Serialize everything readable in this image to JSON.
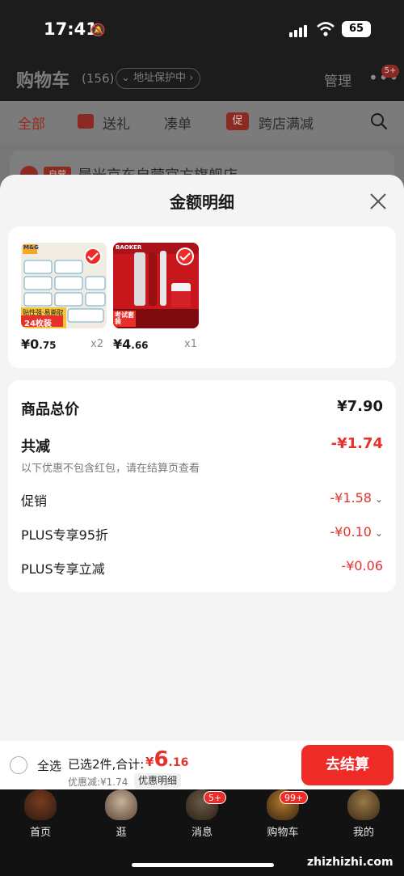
{
  "status_bar": {
    "time": "17:41",
    "battery": "65"
  },
  "header": {
    "title": "购物车",
    "count": "(156)",
    "address_protect": "地址保护中",
    "manage": "管理",
    "more_badge": "5+"
  },
  "filters": [
    {
      "label": "全部"
    },
    {
      "label": "送礼"
    },
    {
      "label": "凑单"
    },
    {
      "label": "跨店满减",
      "tag": "促"
    }
  ],
  "shop": {
    "badge": "自营",
    "name": "晨光京东自营官方旗舰店"
  },
  "sheet": {
    "title": "金额明细",
    "products": [
      {
        "price_int": "¥0",
        "price_dec": ".75",
        "qty": "x2",
        "thumb_tag": "24枚装",
        "thumb_brand": "M&G",
        "thumb_caption": "贴性强·易撕取"
      },
      {
        "price_int": "¥4",
        "price_dec": ".66",
        "qty": "x1",
        "thumb_tag": "考试套装",
        "thumb_brand": "BAOKER"
      }
    ],
    "summary": {
      "goods_total_label": "商品总价",
      "goods_total_value": "¥7.90",
      "total_discount_label": "共减",
      "total_discount_value": "-¥1.74",
      "note": "以下优惠不包含红包，请在结算页查看",
      "rows": [
        {
          "label": "促销",
          "value": "-¥1.58"
        },
        {
          "label": "PLUS专享95折",
          "value": "-¥0.10"
        },
        {
          "label": "PLUS专享立减",
          "value": "-¥0.06"
        }
      ]
    }
  },
  "bottom_bar": {
    "select_all": "全选",
    "selected": "已选2件,合计:",
    "currency": "¥",
    "total_int": "6",
    "total_dec": ".16",
    "discount": "优惠减:¥1.74",
    "detail": "优惠明细",
    "checkout": "去结算"
  },
  "tabbar": [
    {
      "label": "首页"
    },
    {
      "label": "逛"
    },
    {
      "label": "消息",
      "badge": "5+"
    },
    {
      "label": "购物车",
      "badge": "99+"
    },
    {
      "label": "我的"
    }
  ],
  "watermark": "zhizhizhi.com",
  "colors": {
    "accent": "#ef2b28",
    "discount_red": "#e5322d",
    "sheet_bg": "#f4f4f4"
  }
}
